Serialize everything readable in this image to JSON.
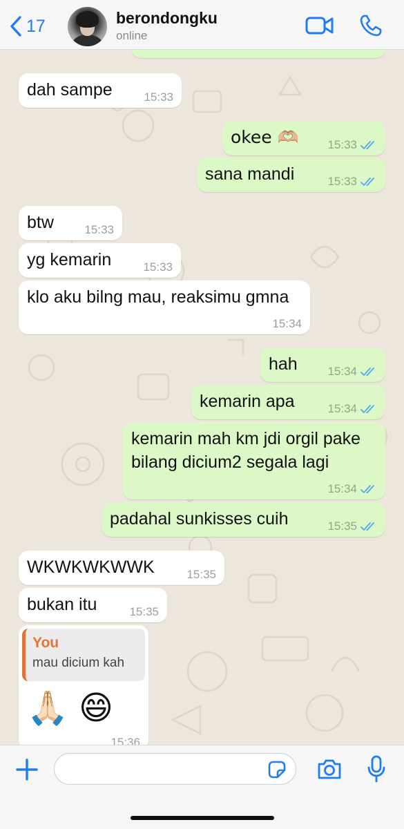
{
  "header": {
    "back_count": "17",
    "contact_name": "berondongku",
    "contact_status": "online"
  },
  "messages": [
    {
      "side": "in",
      "text": "dah sampe",
      "time": "15:33"
    },
    {
      "side": "out",
      "text": "okee 🫶🏼",
      "time": "15:33",
      "ticks": "read"
    },
    {
      "side": "out",
      "text": "sana mandi",
      "time": "15:33",
      "ticks": "read"
    },
    {
      "side": "in",
      "text": "btw",
      "time": "15:33"
    },
    {
      "side": "in",
      "text": "yg kemarin",
      "time": "15:33"
    },
    {
      "side": "in",
      "text": "klo aku bilng mau, reaksimu gmna",
      "time": "15:34"
    },
    {
      "side": "out",
      "text": "hah",
      "time": "15:34",
      "ticks": "read"
    },
    {
      "side": "out",
      "text": "kemarin apa",
      "time": "15:34",
      "ticks": "read"
    },
    {
      "side": "out",
      "text": "kemarin mah km jdi orgil pake\nbilang dicium2 segala lagi",
      "time": "15:34",
      "ticks": "read"
    },
    {
      "side": "out",
      "text": "padahal sunkisses cuih",
      "time": "15:35",
      "ticks": "read"
    },
    {
      "side": "in",
      "text": "WKWKWKWWK",
      "time": "15:35"
    },
    {
      "side": "in",
      "text": "bukan itu",
      "time": "15:35"
    },
    {
      "side": "in",
      "quote_author": "You",
      "quote_text": "mau dicium kah",
      "text": "🙏🏻 😄",
      "time": "15:36"
    }
  ],
  "composer": {
    "input_value": "",
    "input_placeholder": ""
  },
  "colors": {
    "accent": "#1f7cf5",
    "outgoing_bubble": "#dcf8c6",
    "incoming_bubble": "#ffffff",
    "quote_accent": "#e2743b",
    "read_ticks": "#4fa8f2"
  }
}
